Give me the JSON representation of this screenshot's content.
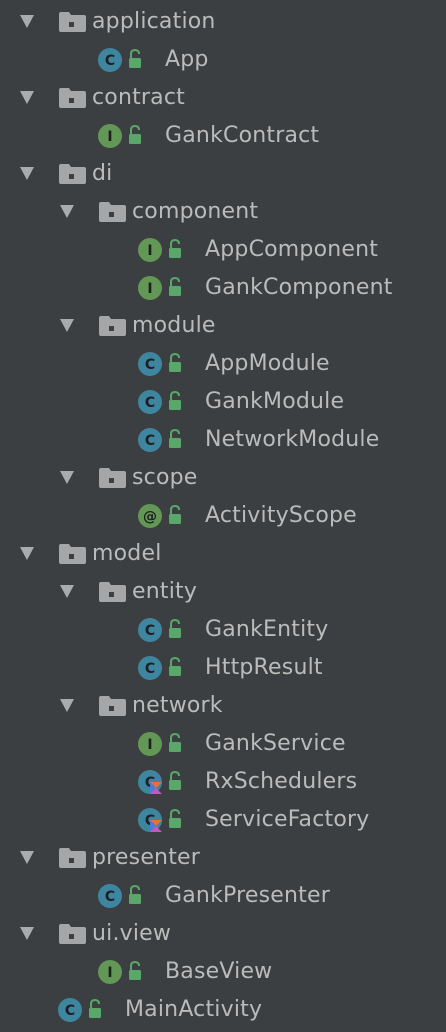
{
  "colors": {
    "background": "#3c3f41",
    "text": "#bbbbbb",
    "class_badge": "#3e86a0",
    "interface_badge": "#629755",
    "annotation_badge": "#629755",
    "kotlin_orange": "#e8703a",
    "kotlin_blue": "#4b7bd9",
    "lock_green": "#59a869"
  },
  "tree": {
    "nodes": [
      {
        "label": "application",
        "type": "package",
        "icon": "folder-icon",
        "depth": 0
      },
      {
        "label": "App",
        "type": "class",
        "icon": "class-icon",
        "depth": 1
      },
      {
        "label": "contract",
        "type": "package",
        "icon": "folder-icon",
        "depth": 0
      },
      {
        "label": "GankContract",
        "type": "interface",
        "icon": "interface-icon",
        "depth": 1
      },
      {
        "label": "di",
        "type": "package",
        "icon": "folder-icon",
        "depth": 0
      },
      {
        "label": "component",
        "type": "package",
        "icon": "folder-icon",
        "depth": 1
      },
      {
        "label": "AppComponent",
        "type": "interface",
        "icon": "interface-icon",
        "depth": 2
      },
      {
        "label": "GankComponent",
        "type": "interface",
        "icon": "interface-icon",
        "depth": 2
      },
      {
        "label": "module",
        "type": "package",
        "icon": "folder-icon",
        "depth": 1
      },
      {
        "label": "AppModule",
        "type": "class",
        "icon": "class-icon",
        "depth": 2
      },
      {
        "label": "GankModule",
        "type": "class",
        "icon": "class-icon",
        "depth": 2
      },
      {
        "label": "NetworkModule",
        "type": "class",
        "icon": "class-icon",
        "depth": 2
      },
      {
        "label": "scope",
        "type": "package",
        "icon": "folder-icon",
        "depth": 1
      },
      {
        "label": "ActivityScope",
        "type": "annotation",
        "icon": "annotation-icon",
        "depth": 2
      },
      {
        "label": "model",
        "type": "package",
        "icon": "folder-icon",
        "depth": 0
      },
      {
        "label": "entity",
        "type": "package",
        "icon": "folder-icon",
        "depth": 1
      },
      {
        "label": "GankEntity",
        "type": "class",
        "icon": "class-icon",
        "depth": 2
      },
      {
        "label": "HttpResult",
        "type": "class",
        "icon": "class-icon",
        "depth": 2
      },
      {
        "label": "network",
        "type": "package",
        "icon": "folder-icon",
        "depth": 1
      },
      {
        "label": "GankService",
        "type": "interface",
        "icon": "interface-icon",
        "depth": 2
      },
      {
        "label": "RxSchedulers",
        "type": "kotlin-class",
        "icon": "kotlin-class-icon",
        "depth": 2
      },
      {
        "label": "ServiceFactory",
        "type": "kotlin-class",
        "icon": "kotlin-class-icon",
        "depth": 2
      },
      {
        "label": "presenter",
        "type": "package",
        "icon": "folder-icon",
        "depth": 0
      },
      {
        "label": "GankPresenter",
        "type": "class",
        "icon": "class-icon",
        "depth": 1
      },
      {
        "label": "ui.view",
        "type": "package",
        "icon": "folder-icon",
        "depth": 0
      },
      {
        "label": "BaseView",
        "type": "interface",
        "icon": "interface-icon",
        "depth": 1
      },
      {
        "label": "MainActivity",
        "type": "class",
        "icon": "class-icon",
        "depth": 0
      }
    ]
  }
}
